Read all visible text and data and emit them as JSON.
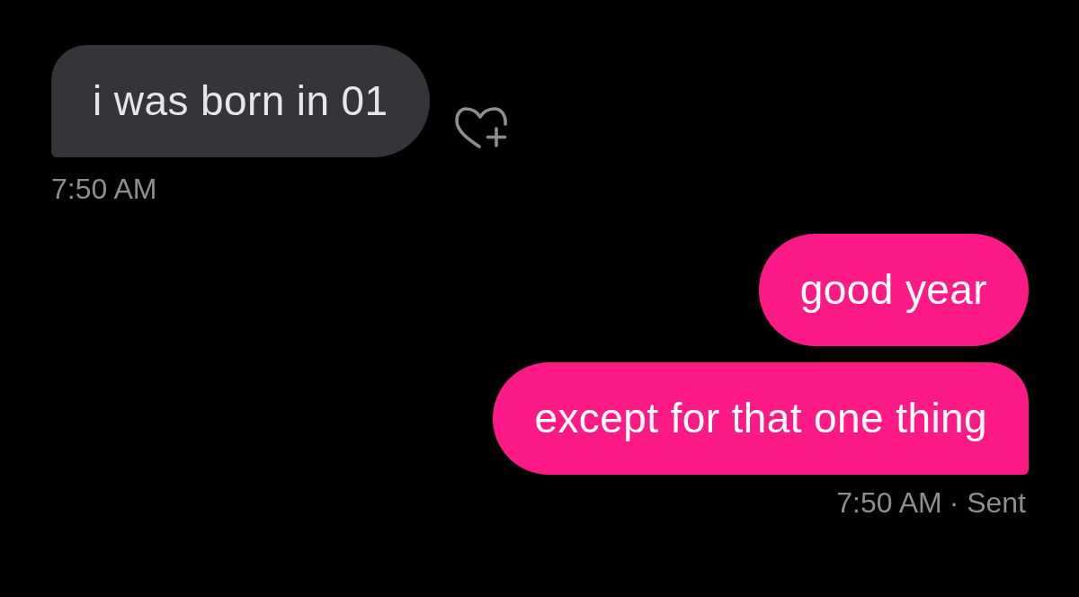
{
  "conversation": [
    {
      "kind": "received",
      "bubbles": [
        "i was born in 01"
      ],
      "react_icon": true,
      "timestamp": "7:50 AM"
    },
    {
      "kind": "sent",
      "bubbles": [
        "good year",
        "except for that one thing"
      ],
      "timestamp": "7:50 AM",
      "status": "· Sent"
    }
  ]
}
